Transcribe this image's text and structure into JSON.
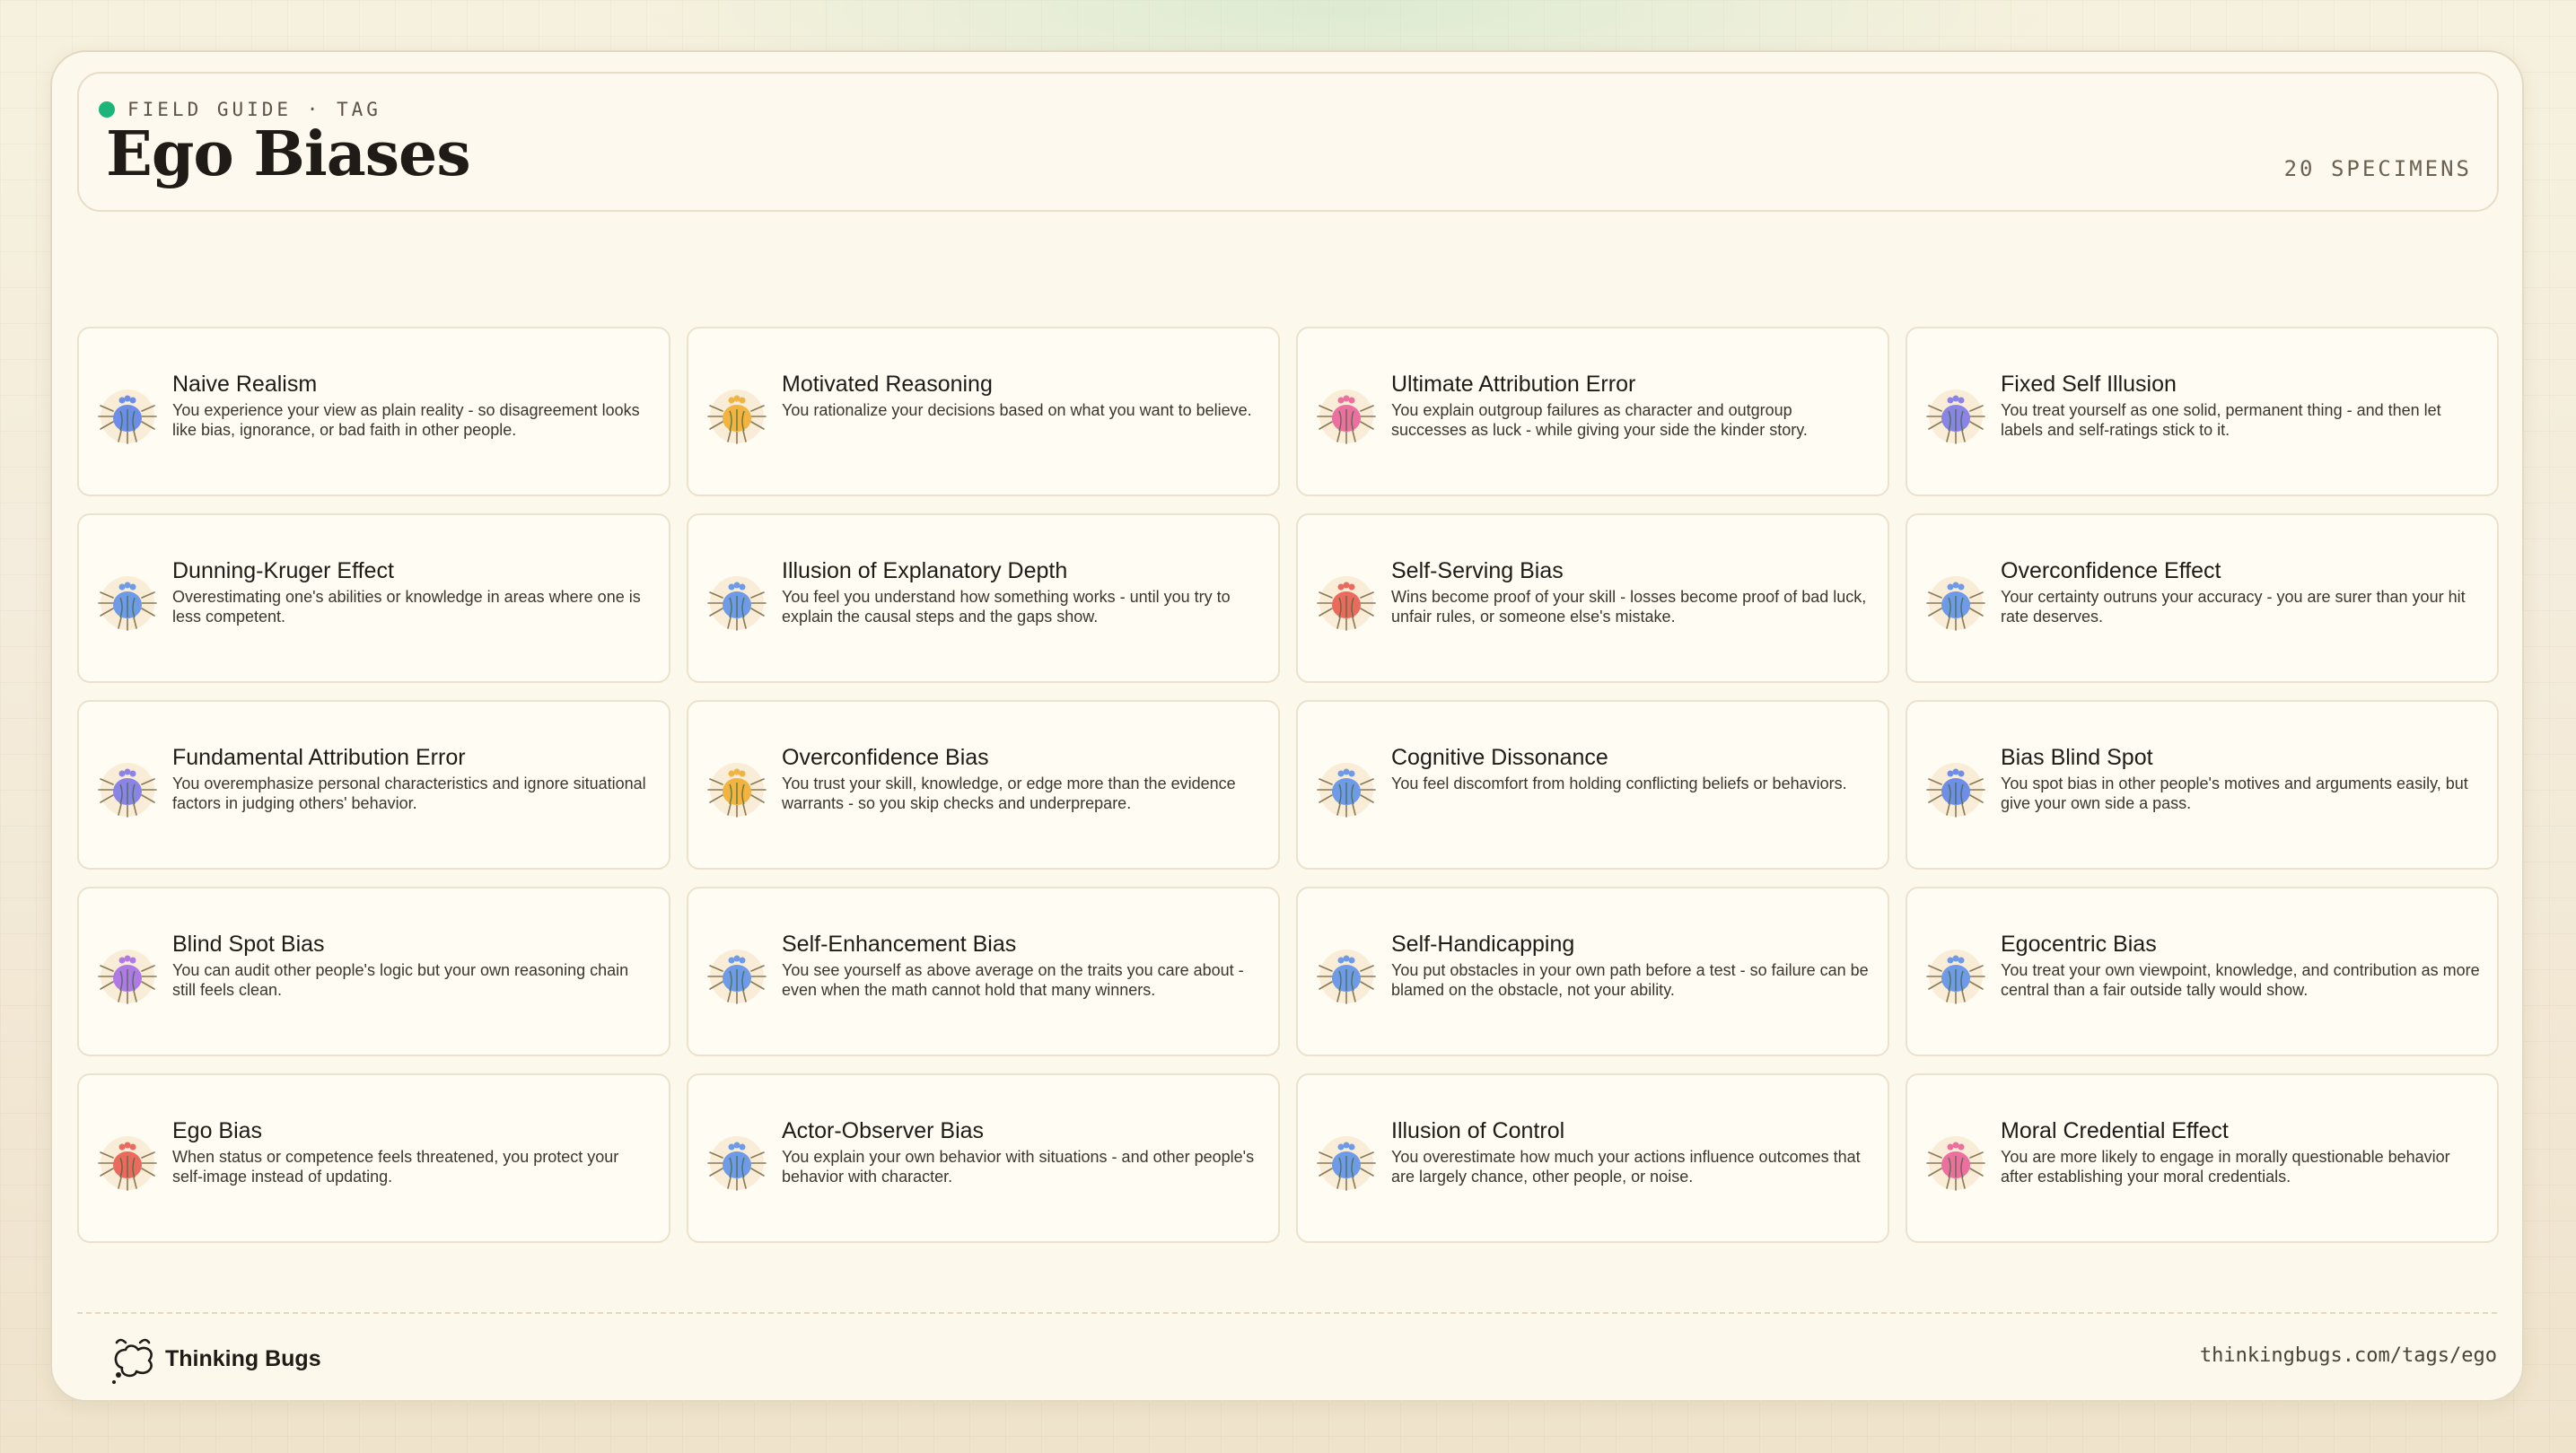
{
  "header": {
    "eyebrow": "FIELD GUIDE · TAG",
    "title": "Ego Biases",
    "count": "20 SPECIMENS"
  },
  "specimens": [
    {
      "title": "Naive Realism",
      "desc": "You experience your view as plain reality - so disagreement looks like bias, ignorance, or bad faith in other people.",
      "color": "#6c8ee8",
      "icon": "blue-bug-icon"
    },
    {
      "title": "Motivated Reasoning",
      "desc": "You rationalize your decisions based on what you want to believe.",
      "color": "#f2b340",
      "icon": "orange-bug-icon"
    },
    {
      "title": "Ultimate Attribution Error",
      "desc": "You explain outgroup failures as character and outgroup successes as luck - while giving your side the kinder story.",
      "color": "#ec6fa0",
      "icon": "pink-bug-icon"
    },
    {
      "title": "Fixed Self Illusion",
      "desc": "You treat yourself as one solid, permanent thing - and then let labels and self-ratings stick to it.",
      "color": "#8a84e6",
      "icon": "purple-bug-icon"
    },
    {
      "title": "Dunning-Kruger Effect",
      "desc": "Overestimating one's abilities or knowledge in areas where one is less competent.",
      "color": "#6f9ae8",
      "icon": "blue-bug-icon"
    },
    {
      "title": "Illusion of Explanatory Depth",
      "desc": "You feel you understand how something works - until you try to explain the causal steps and the gaps show.",
      "color": "#6f9ae8",
      "icon": "blue-bug-icon"
    },
    {
      "title": "Self-Serving Bias",
      "desc": "Wins become proof of your skill - losses become proof of bad luck, unfair rules, or someone else's mistake.",
      "color": "#ea6a5e",
      "icon": "red-bug-icon"
    },
    {
      "title": "Overconfidence Effect",
      "desc": "Your certainty outruns your accuracy - you are surer than your hit rate deserves.",
      "color": "#6f9ae8",
      "icon": "blue-bug-icon"
    },
    {
      "title": "Fundamental Attribution Error",
      "desc": "You overemphasize personal characteristics and ignore situational factors in judging others' behavior.",
      "color": "#8a84e6",
      "icon": "purple-bug-icon"
    },
    {
      "title": "Overconfidence Bias",
      "desc": "You trust your skill, knowledge, or edge more than the evidence warrants - so you skip checks and underprepare.",
      "color": "#f2b340",
      "icon": "orange-bug-icon"
    },
    {
      "title": "Cognitive Dissonance",
      "desc": "You feel discomfort from holding conflicting beliefs or behaviors.",
      "color": "#6f9ae8",
      "icon": "blue-bug-icon"
    },
    {
      "title": "Bias Blind Spot",
      "desc": "You spot bias in other people's motives and arguments easily, but give your own side a pass.",
      "color": "#6f8ee8",
      "icon": "blue-bug-icon"
    },
    {
      "title": "Blind Spot Bias",
      "desc": "You can audit other people's logic but your own reasoning chain still feels clean.",
      "color": "#b07ae6",
      "icon": "violet-bug-icon"
    },
    {
      "title": "Self-Enhancement Bias",
      "desc": "You see yourself as above average on the traits you care about - even when the math cannot hold that many winners.",
      "color": "#6f9ae8",
      "icon": "blue-bug-icon"
    },
    {
      "title": "Self-Handicapping",
      "desc": "You put obstacles in your own path before a test - so failure can be blamed on the obstacle, not your ability.",
      "color": "#6f9ae8",
      "icon": "blue-bug-icon"
    },
    {
      "title": "Egocentric Bias",
      "desc": "You treat your own viewpoint, knowledge, and contribution as more central than a fair outside tally would show.",
      "color": "#6f9ae8",
      "icon": "blue-bug-icon"
    },
    {
      "title": "Ego Bias",
      "desc": "When status or competence feels threatened, you protect your self-image instead of updating.",
      "color": "#ea6a5e",
      "icon": "red-bug-icon"
    },
    {
      "title": "Actor-Observer Bias",
      "desc": "You explain your own behavior with situations - and other people's behavior with character.",
      "color": "#6f9ae8",
      "icon": "blue-bug-icon"
    },
    {
      "title": "Illusion of Control",
      "desc": "You overestimate how much your actions influence outcomes that are largely chance, other people, or noise.",
      "color": "#6f9ae8",
      "icon": "blue-bug-icon"
    },
    {
      "title": "Moral Credential Effect",
      "desc": "You are more likely to engage in morally questionable behavior after establishing your moral credentials.",
      "color": "#ec6fa0",
      "icon": "pink-bug-icon"
    }
  ],
  "footer": {
    "brand": "Thinking Bugs",
    "url": "thinkingbugs.com/tags/ego"
  },
  "colors": {
    "accent_dot": "#1bb57a",
    "card_bg": "#fffcf3",
    "frame_bg": "#fcf8ec"
  }
}
